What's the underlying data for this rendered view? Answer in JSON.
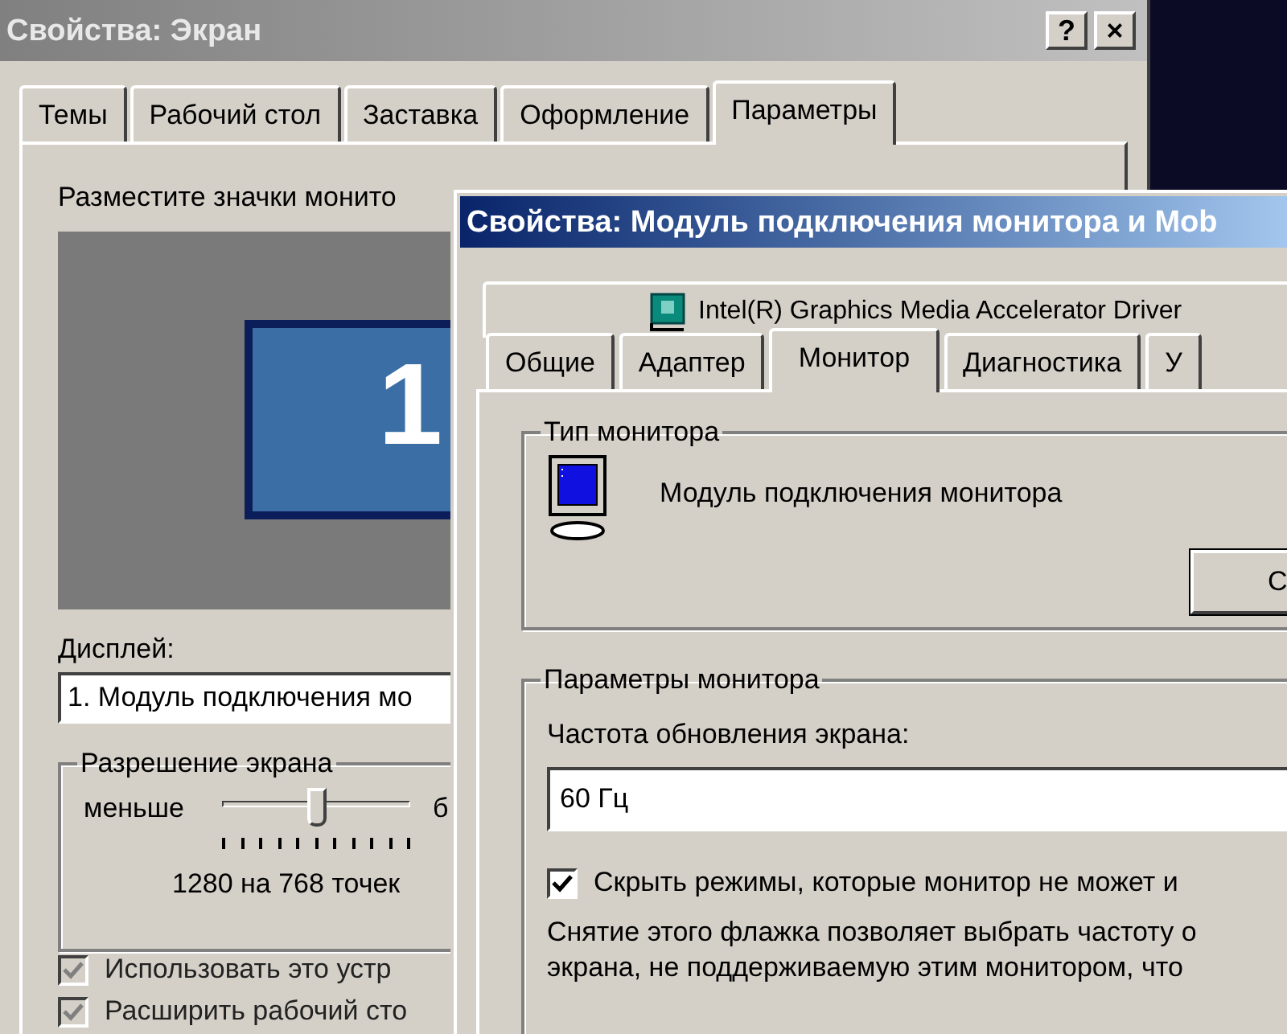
{
  "display_dialog": {
    "title": "Свойства: Экран",
    "active": false,
    "title_buttons": [
      "?",
      "×"
    ],
    "tabs": [
      {
        "label": "Темы",
        "selected": false
      },
      {
        "label": "Рабочий стол",
        "selected": false
      },
      {
        "label": "Заставка",
        "selected": false
      },
      {
        "label": "Оформление",
        "selected": false
      },
      {
        "label": "Параметры",
        "selected": true
      }
    ],
    "arrange_label": "Разместите значки монито",
    "preview_number": "1",
    "display_label": "Дисплей:",
    "display_value": "1. Модуль подключения мо",
    "resolution": {
      "title": "Разрешение экрана",
      "min_label": "меньше",
      "max_label": "б",
      "level": 0.5,
      "reading": "1280 на 768 точек"
    },
    "checkboxes": [
      {
        "label": "Использовать это устр",
        "checked": true,
        "disabled": true
      },
      {
        "label": "Расширить рабочий сто",
        "checked": true,
        "disabled": true
      }
    ]
  },
  "monitor_dialog": {
    "title": "Свойства: Модуль подключения монитора и Mob",
    "active": true,
    "tabs_row_1": [
      {
        "label": "Intel(R) Graphics Media Accelerator Driver",
        "selected": false
      }
    ],
    "tabs": [
      {
        "label": "Общие",
        "selected": false
      },
      {
        "label": "Адаптер",
        "selected": false
      },
      {
        "label": "Монитор",
        "selected": true
      },
      {
        "label": "Диагностика",
        "selected": false
      },
      {
        "label": "У",
        "selected": false
      }
    ],
    "monitor_type": {
      "title": "Тип монитора",
      "name": "Модуль подключения монитора",
      "button": "С"
    },
    "monitor_settings": {
      "title": "Параметры монитора",
      "refresh_label": "Частота обновления экрана:",
      "refresh_value": "60 Гц",
      "hide_modes": {
        "label": "Скрыть режимы, которые монитор не может и",
        "checked": true
      },
      "description": [
        "Снятие этого флажка позволяет выбрать частоту о",
        "экрана, не поддерживаемую этим монитором, что"
      ]
    }
  }
}
